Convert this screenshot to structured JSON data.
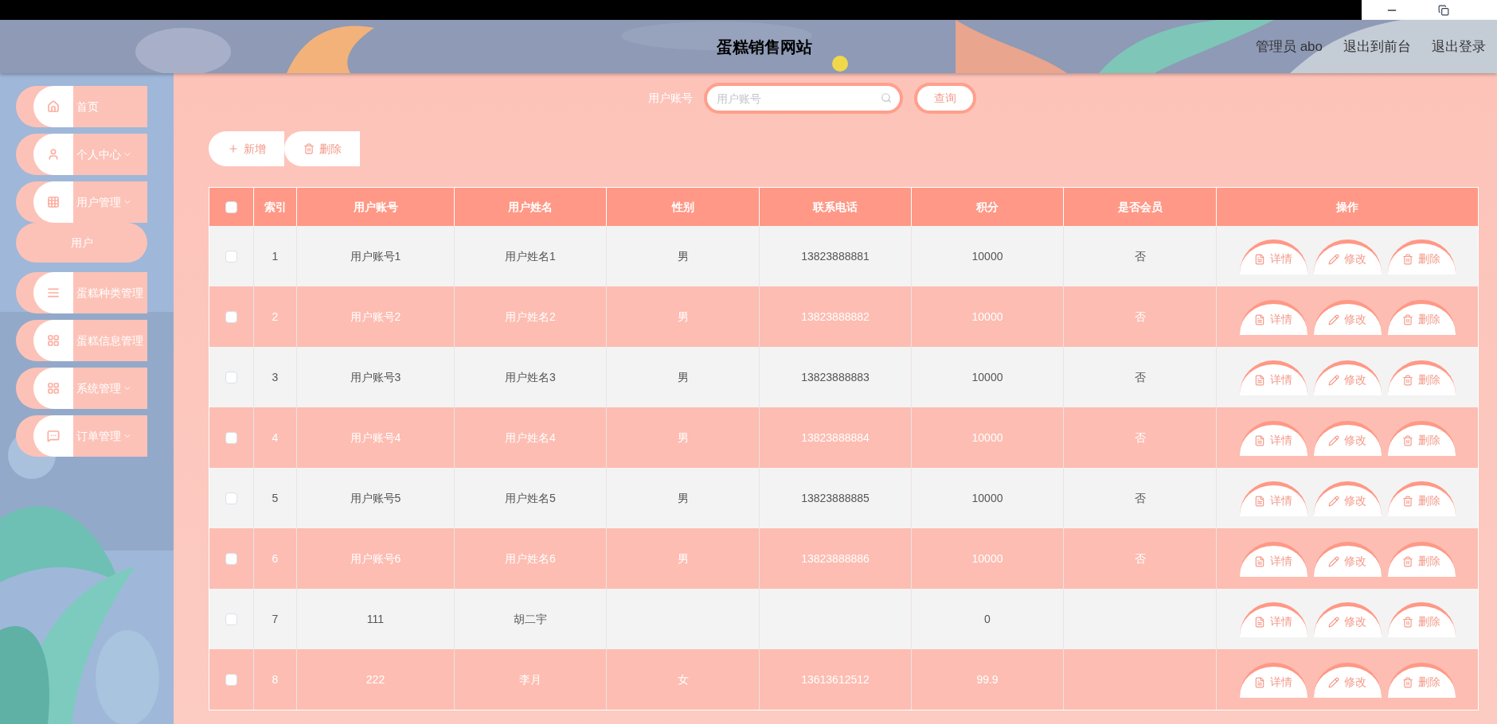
{
  "header": {
    "title": "蛋糕销售网站",
    "links": [
      "管理员 abo",
      "退出到前台",
      "退出登录"
    ]
  },
  "sidebar": {
    "items": [
      {
        "label": "首页",
        "expandable": false
      },
      {
        "label": "个人中心",
        "expandable": true
      },
      {
        "label": "用户管理",
        "expandable": true,
        "children": [
          {
            "label": "用户"
          }
        ]
      },
      {
        "label": "蛋糕种类管理",
        "expandable": false
      },
      {
        "label": "蛋糕信息管理",
        "expandable": false
      },
      {
        "label": "系统管理",
        "expandable": true
      },
      {
        "label": "订单管理",
        "expandable": true
      }
    ]
  },
  "search": {
    "label": "用户账号",
    "placeholder": "用户账号",
    "button": "查询"
  },
  "toolbar": [
    {
      "kind": "add",
      "label": "新增"
    },
    {
      "kind": "delete",
      "label": "删除"
    }
  ],
  "table": {
    "select_all": {
      "checked": false
    },
    "columns": [
      "索引",
      "用户账号",
      "用户姓名",
      "性别",
      "联系电话",
      "积分",
      "是否会员",
      "操作"
    ],
    "rows": [
      {
        "checked": false,
        "index": "1",
        "account": "用户账号1",
        "name": "用户姓名1",
        "gender": "男",
        "phone": "13823888881",
        "points": "10000",
        "member": "否",
        "actions": [
          {
            "kind": "detail",
            "label": "详情"
          },
          {
            "kind": "edit",
            "label": "修改"
          },
          {
            "kind": "delete",
            "label": "删除"
          }
        ]
      },
      {
        "checked": false,
        "index": "2",
        "account": "用户账号2",
        "name": "用户姓名2",
        "gender": "男",
        "phone": "13823888882",
        "points": "10000",
        "member": "否",
        "actions": [
          {
            "kind": "detail",
            "label": "详情"
          },
          {
            "kind": "edit",
            "label": "修改"
          },
          {
            "kind": "delete",
            "label": "删除"
          }
        ]
      },
      {
        "checked": false,
        "index": "3",
        "account": "用户账号3",
        "name": "用户姓名3",
        "gender": "男",
        "phone": "13823888883",
        "points": "10000",
        "member": "否",
        "actions": [
          {
            "kind": "detail",
            "label": "详情"
          },
          {
            "kind": "edit",
            "label": "修改"
          },
          {
            "kind": "delete",
            "label": "删除"
          }
        ]
      },
      {
        "checked": false,
        "index": "4",
        "account": "用户账号4",
        "name": "用户姓名4",
        "gender": "男",
        "phone": "13823888884",
        "points": "10000",
        "member": "否",
        "actions": [
          {
            "kind": "detail",
            "label": "详情"
          },
          {
            "kind": "edit",
            "label": "修改"
          },
          {
            "kind": "delete",
            "label": "删除"
          }
        ]
      },
      {
        "checked": false,
        "index": "5",
        "account": "用户账号5",
        "name": "用户姓名5",
        "gender": "男",
        "phone": "13823888885",
        "points": "10000",
        "member": "否",
        "actions": [
          {
            "kind": "detail",
            "label": "详情"
          },
          {
            "kind": "edit",
            "label": "修改"
          },
          {
            "kind": "delete",
            "label": "删除"
          }
        ]
      },
      {
        "checked": false,
        "index": "6",
        "account": "用户账号6",
        "name": "用户姓名6",
        "gender": "男",
        "phone": "13823888886",
        "points": "10000",
        "member": "否",
        "actions": [
          {
            "kind": "detail",
            "label": "详情"
          },
          {
            "kind": "edit",
            "label": "修改"
          },
          {
            "kind": "delete",
            "label": "删除"
          }
        ]
      },
      {
        "checked": false,
        "index": "7",
        "account": "111",
        "name": "胡二宇",
        "points": "0",
        "actions": [
          {
            "kind": "detail",
            "label": "详情"
          },
          {
            "kind": "edit",
            "label": "修改"
          },
          {
            "kind": "delete",
            "label": "删除"
          }
        ]
      },
      {
        "checked": false,
        "index": "8",
        "account": "222",
        "name": "李月",
        "gender": "女",
        "phone": "13613612512",
        "points": "99.9",
        "actions": [
          {
            "kind": "detail",
            "label": "详情"
          },
          {
            "kind": "edit",
            "label": "修改"
          },
          {
            "kind": "delete",
            "label": "删除"
          }
        ]
      }
    ]
  }
}
